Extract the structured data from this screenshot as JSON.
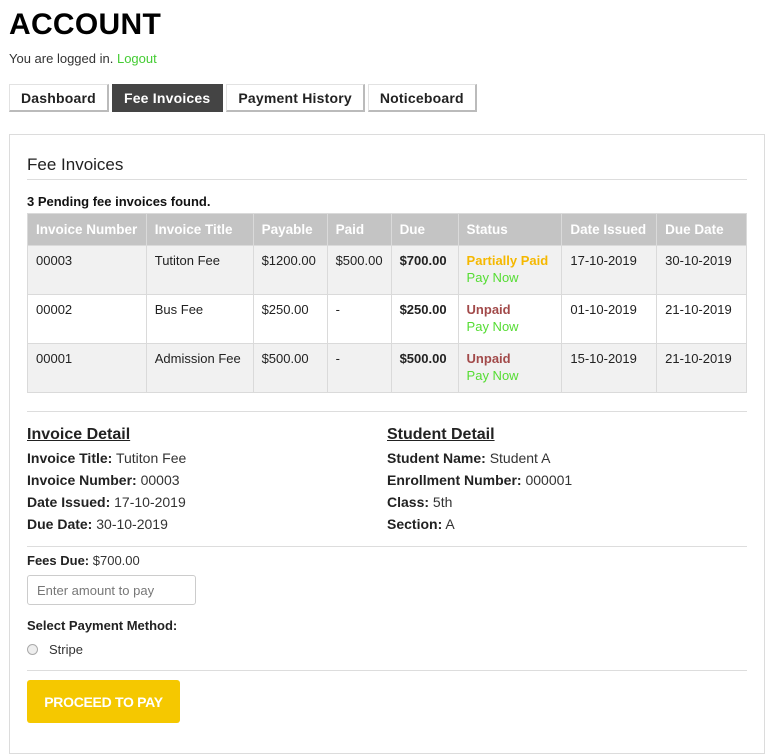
{
  "header": {
    "title": "ACCOUNT",
    "login_text": "You are logged in.",
    "logout_label": "Logout"
  },
  "tabs": [
    {
      "label": "Dashboard",
      "active": false
    },
    {
      "label": "Fee Invoices",
      "active": true
    },
    {
      "label": "Payment History",
      "active": false
    },
    {
      "label": "Noticeboard",
      "active": false
    }
  ],
  "panel": {
    "heading": "Fee Invoices",
    "found_text": "3 Pending fee invoices found."
  },
  "table": {
    "columns": [
      "Invoice Number",
      "Invoice Title",
      "Payable",
      "Paid",
      "Due",
      "Status",
      "Date Issued",
      "Due Date"
    ],
    "rows": [
      {
        "number": "00003",
        "title": "Tutiton Fee",
        "payable": "$1200.00",
        "paid": "$500.00",
        "due": "$700.00",
        "status": "Partially Paid",
        "status_type": "partial",
        "action": "Pay Now",
        "issued": "17-10-2019",
        "due_date": "30-10-2019"
      },
      {
        "number": "00002",
        "title": "Bus Fee",
        "payable": "$250.00",
        "paid": "-",
        "due": "$250.00",
        "status": "Unpaid",
        "status_type": "unpaid",
        "action": "Pay Now",
        "issued": "01-10-2019",
        "due_date": "21-10-2019"
      },
      {
        "number": "00001",
        "title": "Admission Fee",
        "payable": "$500.00",
        "paid": "-",
        "due": "$500.00",
        "status": "Unpaid",
        "status_type": "unpaid",
        "action": "Pay Now",
        "issued": "15-10-2019",
        "due_date": "21-10-2019"
      }
    ]
  },
  "invoice_detail": {
    "heading": "Invoice Detail",
    "fields": [
      {
        "label": "Invoice Title:",
        "value": "Tutiton Fee"
      },
      {
        "label": "Invoice Number:",
        "value": "00003"
      },
      {
        "label": "Date Issued:",
        "value": "17-10-2019"
      },
      {
        "label": "Due Date:",
        "value": "30-10-2019"
      }
    ]
  },
  "student_detail": {
    "heading": "Student Detail",
    "fields": [
      {
        "label": "Student Name:",
        "value": "Student A"
      },
      {
        "label": "Enrollment Number:",
        "value": "000001"
      },
      {
        "label": "Class:",
        "value": "5th"
      },
      {
        "label": "Section:",
        "value": "A"
      }
    ]
  },
  "payment": {
    "fees_due_label": "Fees Due:",
    "fees_due_value": "$700.00",
    "amount_placeholder": "Enter amount to pay",
    "amount_value": "",
    "method_label": "Select Payment Method:",
    "methods": [
      {
        "label": "Stripe",
        "selected": false
      }
    ],
    "proceed_label": "PROCEED TO PAY"
  },
  "colors": {
    "active_tab": "#444444",
    "link_green": "#55dd33",
    "partial_status": "#f5b800",
    "unpaid_status": "#a24a4a",
    "proceed_button": "#f5c800",
    "table_header": "#c4c4c4"
  }
}
